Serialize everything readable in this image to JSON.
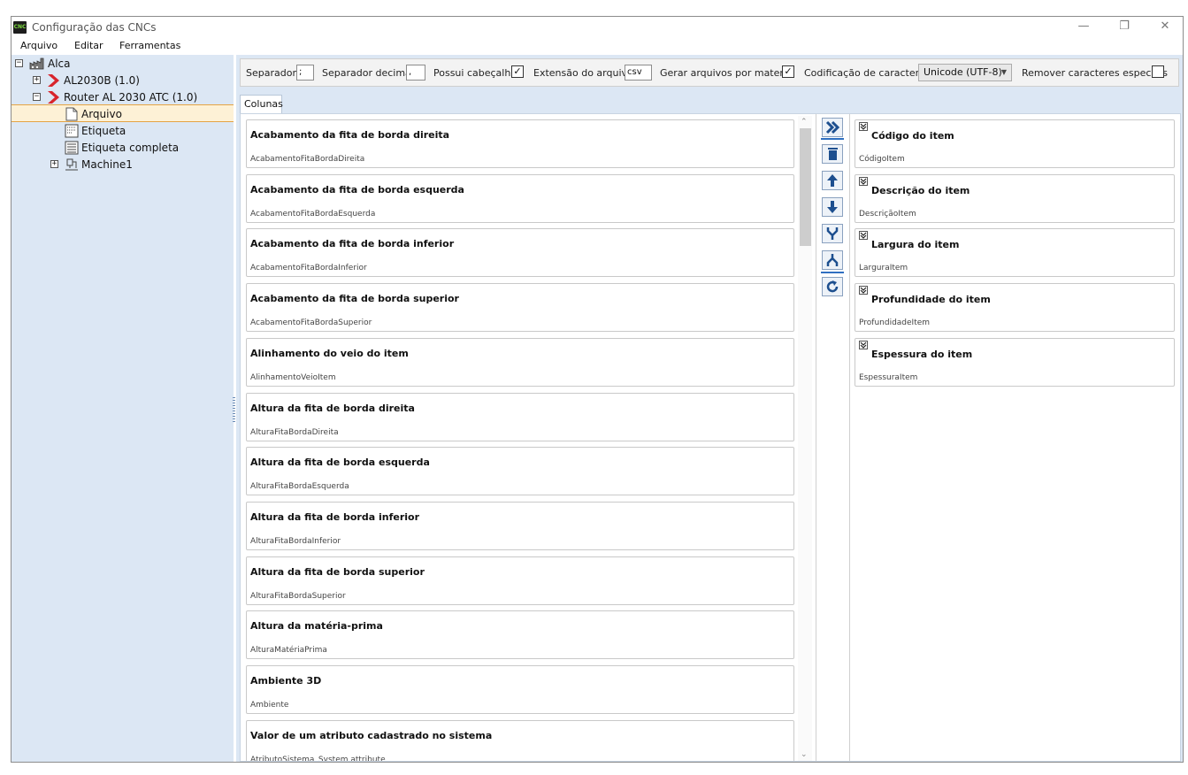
{
  "window": {
    "title": "Configuração das CNCs",
    "icon_label": "CNC",
    "controls": {
      "minimize": "—",
      "restore": "❐",
      "close": "✕"
    }
  },
  "menubar": [
    "Arquivo",
    "Editar",
    "Ferramentas"
  ],
  "tree": {
    "root": "Alca",
    "machine1": "AL2030B (1.0)",
    "machine2": "Router AL 2030 ATC (1.0)",
    "children": [
      "Arquivo",
      "Etiqueta",
      "Etiqueta completa"
    ],
    "sub": "Machine1",
    "selected": "Arquivo"
  },
  "toolbar": {
    "separador_label": "Separador",
    "separador_value": ";",
    "separador_decimal_label": "Separador decimal",
    "separador_decimal_value": ",",
    "possui_cabecalho_label": "Possui cabeçalho",
    "possui_cabecalho_checked": true,
    "extensao_label": "Extensão do arquivo",
    "extensao_value": "csv",
    "gerar_label": "Gerar arquivos por material",
    "gerar_checked": true,
    "codificacao_label": "Codificação de caracteres",
    "codificacao_value": "Unicode (UTF-8)",
    "remover_label": "Remover caracteres especiais",
    "remover_checked": false,
    "check_mark": "✓"
  },
  "tabs": [
    "Colunas"
  ],
  "available_columns": [
    {
      "title": "Acabamento da fita de borda direita",
      "key": "AcabamentoFitaBordaDireita"
    },
    {
      "title": "Acabamento da fita de borda esquerda",
      "key": "AcabamentoFitaBordaEsquerda"
    },
    {
      "title": "Acabamento da fita de borda inferior",
      "key": "AcabamentoFitaBordaInferior"
    },
    {
      "title": "Acabamento da fita de borda superior",
      "key": "AcabamentoFitaBordaSuperior"
    },
    {
      "title": "Alinhamento do veio do item",
      "key": "AlinhamentoVeioItem"
    },
    {
      "title": "Altura da fita de borda direita",
      "key": "AlturaFitaBordaDireita"
    },
    {
      "title": "Altura da fita de borda esquerda",
      "key": "AlturaFitaBordaEsquerda"
    },
    {
      "title": "Altura da fita de borda inferior",
      "key": "AlturaFitaBordaInferior"
    },
    {
      "title": "Altura da fita de borda superior",
      "key": "AlturaFitaBordaSuperior"
    },
    {
      "title": "Altura da matéria-prima",
      "key": "AlturaMatériaPrima"
    },
    {
      "title": "Ambiente 3D",
      "key": "Ambiente"
    },
    {
      "title": "Valor de um atributo cadastrado no sistema",
      "key": "AtributoSistema_System attribute"
    }
  ],
  "selected_columns": [
    {
      "title": "Código do item",
      "key": "CódigoItem"
    },
    {
      "title": "Descrição do item",
      "key": "DescriçãoItem"
    },
    {
      "title": "Largura do item",
      "key": "LarguraItem"
    },
    {
      "title": "Profundidade do item",
      "key": "ProfundidadeItem"
    },
    {
      "title": "Espessura do item",
      "key": "EspessuraItem"
    }
  ],
  "action_buttons": [
    "add-all",
    "delete",
    "move-up",
    "move-down",
    "merge",
    "split",
    "refresh"
  ],
  "colors": {
    "accent": "#2f6fc1",
    "tree_bg": "#dce7f4",
    "selection": "#fdf1d6",
    "selection_border": "#e5a444",
    "arrow_red": "#d8242c"
  }
}
